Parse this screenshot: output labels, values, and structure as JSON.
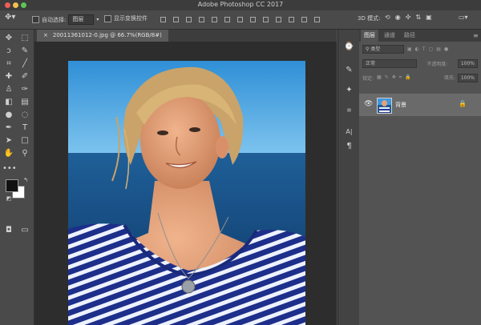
{
  "window": {
    "title": "Adobe Photoshop CC 2017"
  },
  "options_bar": {
    "auto_select_label": "自动选择:",
    "auto_select_value": "图层",
    "show_transform_label": "显示变换控件",
    "mode_label_3d": "3D 模式:"
  },
  "document": {
    "tab_label": "20011361012-0.jpg @ 66.7%(RGB/8#)",
    "close_glyph": "×"
  },
  "layers_panel": {
    "tabs": [
      "图层",
      "通道",
      "路径"
    ],
    "active_tab": "图层",
    "filter_kind": "类型",
    "blend_mode": "正常",
    "opacity_label": "不透明度:",
    "opacity_value": "100%",
    "lock_label": "锁定:",
    "fill_label": "填充:",
    "fill_value": "100%",
    "layers": [
      {
        "name": "背景",
        "visible": true,
        "locked": true
      }
    ]
  },
  "colors": {
    "foreground": "#111111",
    "background": "#ffffff"
  },
  "tools": {
    "left": [
      "move-icon",
      "lasso-icon",
      "crop-icon",
      "healing-brush-icon",
      "clone-stamp-icon",
      "eraser-icon",
      "blur-icon",
      "pen-icon",
      "path-selection-icon",
      "hand-icon",
      "edit-toolbar-icon",
      "quick-mask-icon"
    ],
    "right": [
      "marquee-icon",
      "quick-select-icon",
      "eyedropper-icon",
      "brush-icon",
      "history-brush-icon",
      "gradient-icon",
      "dodge-icon",
      "type-icon",
      "rectangle-icon",
      "zoom-icon",
      "screen-mode-icon"
    ]
  }
}
